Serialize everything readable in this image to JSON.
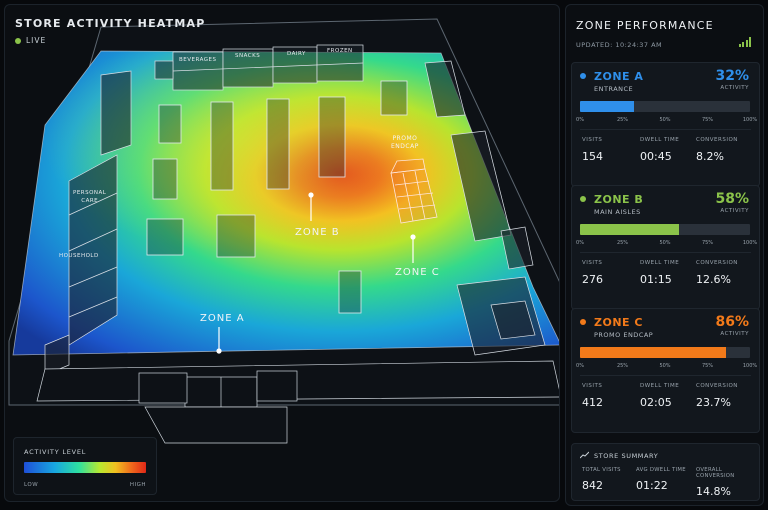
{
  "heatmap": {
    "title": "STORE ACTIVITY HEATMAP",
    "live_label": "LIVE",
    "shelf_labels": [
      "BEVERAGES",
      "SNACKS",
      "DAIRY",
      "FROZEN"
    ],
    "side_labels": {
      "personal_care": "PERSONAL\nCARE",
      "household": "HOUSEHOLD"
    },
    "promo_label": "PROMO\nENDCAP",
    "zone_labels": {
      "a": "ZONE A",
      "b": "ZONE B",
      "c": "ZONE C"
    },
    "legend": {
      "title": "ACTIVITY LEVEL",
      "low": "LOW",
      "high": "HIGH"
    }
  },
  "panel": {
    "title": "ZONE PERFORMANCE",
    "updated": "UPDATED: 10:24:37 AM",
    "accent": "#8bc34a"
  },
  "zones": [
    {
      "name": "ZONE A",
      "subtitle": "ENTRANCE",
      "percent": "32%",
      "activity_fraction": 0.32,
      "activity_label": "ACTIVITY",
      "color": "#2f8fea",
      "ticks": [
        "0%",
        "25%",
        "50%",
        "75%",
        "100%"
      ],
      "metrics": [
        {
          "label": "VISITS",
          "value": "154"
        },
        {
          "label": "DWELL TIME",
          "value": "00:45"
        },
        {
          "label": "CONVERSION",
          "value": "8.2%"
        }
      ]
    },
    {
      "name": "ZONE B",
      "subtitle": "MAIN AISLES",
      "percent": "58%",
      "activity_fraction": 0.58,
      "activity_label": "ACTIVITY",
      "color": "#8bc34a",
      "ticks": [
        "0%",
        "25%",
        "50%",
        "75%",
        "100%"
      ],
      "metrics": [
        {
          "label": "VISITS",
          "value": "276"
        },
        {
          "label": "DWELL TIME",
          "value": "01:15"
        },
        {
          "label": "CONVERSION",
          "value": "12.6%"
        }
      ]
    },
    {
      "name": "ZONE C",
      "subtitle": "PROMO ENDCAP",
      "percent": "86%",
      "activity_fraction": 0.86,
      "activity_label": "ACTIVITY",
      "color": "#f27a1a",
      "ticks": [
        "0%",
        "25%",
        "50%",
        "75%",
        "100%"
      ],
      "metrics": [
        {
          "label": "VISITS",
          "value": "412"
        },
        {
          "label": "DWELL TIME",
          "value": "02:05"
        },
        {
          "label": "CONVERSION",
          "value": "23.7%"
        }
      ]
    }
  ],
  "summary": {
    "title": "STORE SUMMARY",
    "icon": "trend-chart-icon",
    "metrics": [
      {
        "label": "TOTAL VISITS",
        "value": "842"
      },
      {
        "label": "AVG DWELL TIME",
        "value": "01:22"
      },
      {
        "label": "OVERALL CONVERSION",
        "value": "14.8%"
      }
    ]
  }
}
